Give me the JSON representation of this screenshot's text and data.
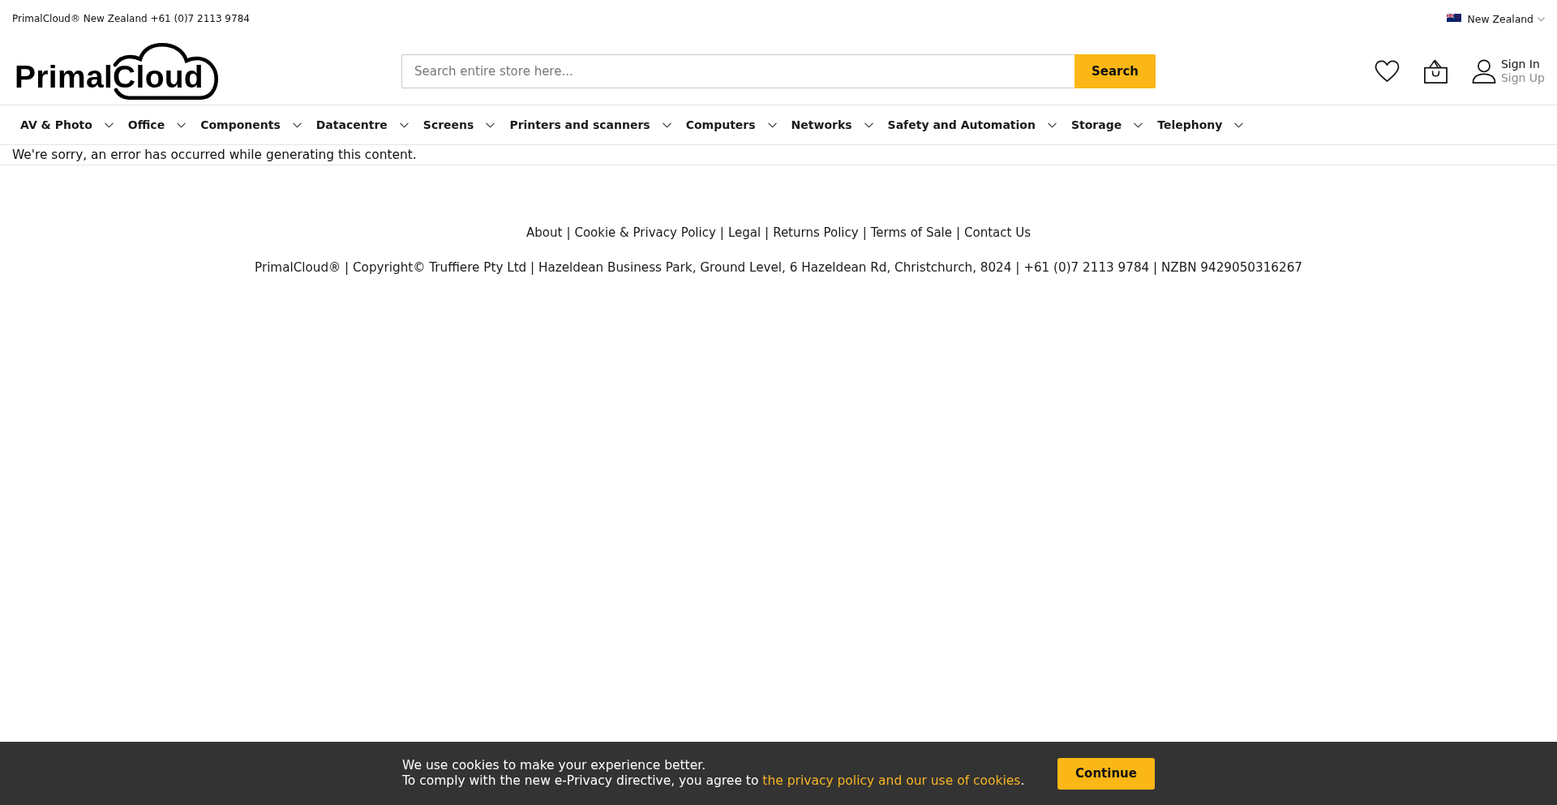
{
  "top_bar": {
    "contact": "PrimalCloud® New Zealand +61 (0)7 2113 9784",
    "region": "New Zealand"
  },
  "header": {
    "logo": "PrimalCloud",
    "search": {
      "placeholder": "Search entire store here...",
      "button": "Search"
    },
    "account": {
      "sign_in": "Sign In",
      "sign_up": "Sign Up"
    }
  },
  "nav": {
    "items": [
      "AV & Photo",
      "Office",
      "Components",
      "Datacentre",
      "Screens",
      "Printers and scanners",
      "Computers",
      "Networks",
      "Safety and Automation",
      "Storage",
      "Telephony"
    ]
  },
  "error_message": "We're sorry, an error has occurred while generating this content.",
  "footer": {
    "links": [
      "About",
      "Cookie & Privacy Policy",
      "Legal",
      "Returns Policy",
      "Terms of Sale",
      "Contact Us"
    ],
    "separator": "|",
    "company_info": "PrimalCloud® | Copyright© Truffiere Pty Ltd | Hazeldean Business Park, Ground Level, 6 Hazeldean Rd, Christchurch, 8024 | +61 (0)7 2113 9784 | NZBN 9429050316267"
  },
  "cookie_bar": {
    "message": "We use cookies to make your experience better.",
    "notice": "To comply with the new e-Privacy directive, you agree to",
    "link": "the privacy policy and our use of cookies",
    "notice_end": ".",
    "button": "Continue"
  }
}
